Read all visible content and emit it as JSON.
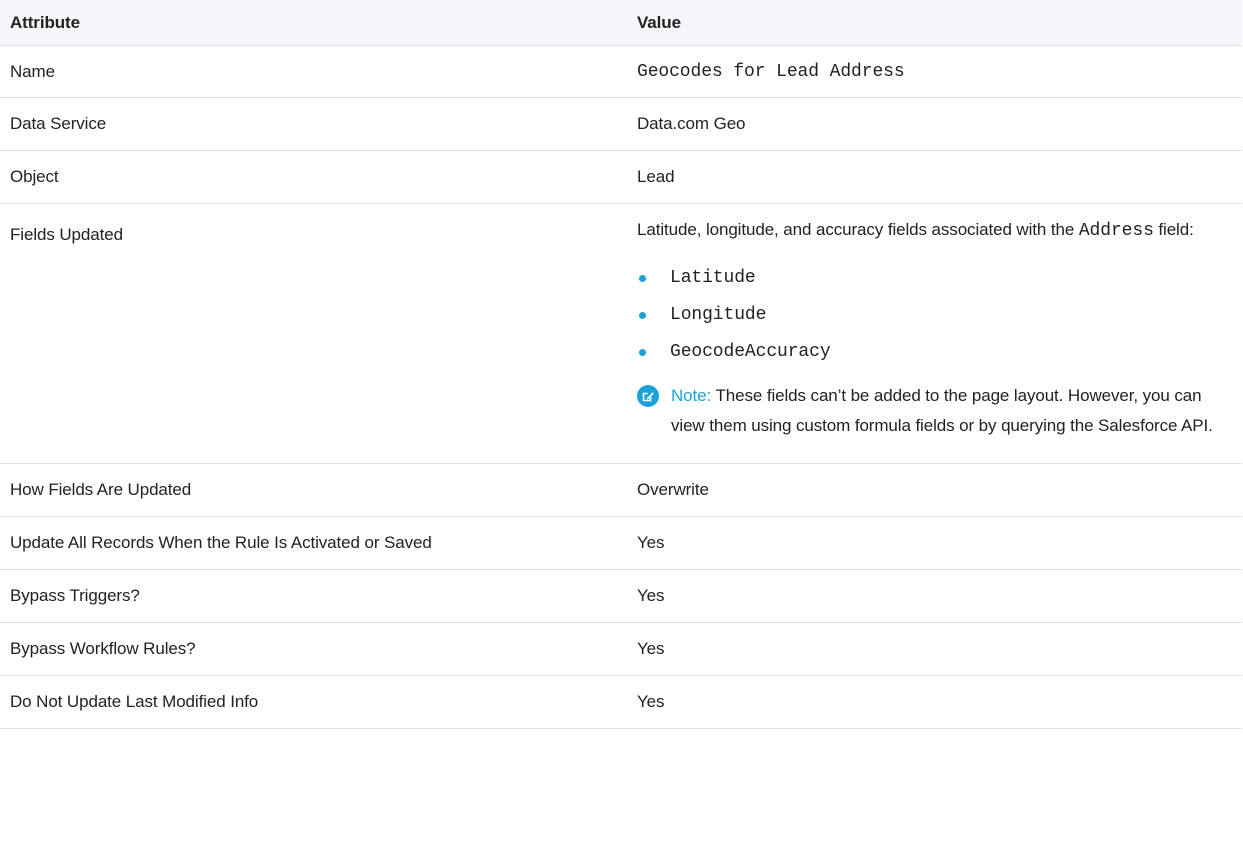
{
  "table": {
    "header": {
      "attribute": "Attribute",
      "value": "Value"
    },
    "rows": {
      "name": {
        "label": "Name",
        "value": "Geocodes for Lead Address"
      },
      "data_service": {
        "label": "Data Service",
        "value": "Data.com Geo"
      },
      "object": {
        "label": "Object",
        "value": "Lead"
      },
      "fields_updated": {
        "label": "Fields Updated",
        "intro_text": "Latitude, longitude, and accuracy fields associated with the",
        "intro_code": "Address",
        "intro_suffix": "field:",
        "fields": [
          "Latitude",
          "Longitude",
          "GeocodeAccuracy"
        ],
        "note_label": "Note:",
        "note_text": "These fields can’t be added to the page layout. However, you can view them using custom formula fields or by querying the Salesforce API.",
        "note_icon": "edit-note-icon"
      },
      "how_updated": {
        "label": "How Fields Are Updated",
        "value": "Overwrite"
      },
      "update_all": {
        "label": "Update All Records When the Rule Is Activated or Saved",
        "value": "Yes"
      },
      "bypass_triggers": {
        "label": "Bypass Triggers?",
        "value": "Yes"
      },
      "bypass_workflow": {
        "label": "Bypass Workflow Rules?",
        "value": "Yes"
      },
      "no_last_modified": {
        "label": "Do Not Update Last Modified Info",
        "value": "Yes"
      }
    }
  },
  "colors": {
    "accent": "#1ba1d9",
    "header_bg": "#f4f6f9",
    "border": "#d8dde6",
    "text": "#222222"
  }
}
